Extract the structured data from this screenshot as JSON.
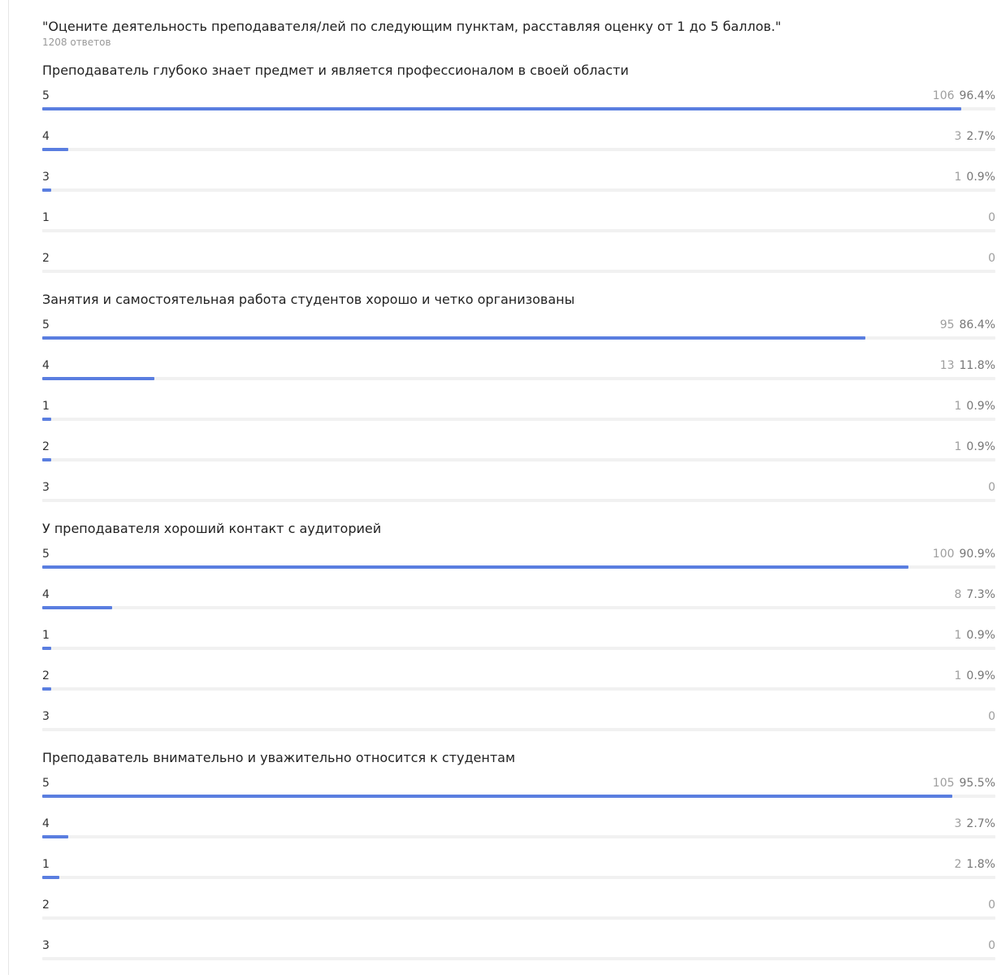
{
  "survey": {
    "question": "\"Оцените деятельность преподавателя/лей по следующим пунктам, расставляя оценку от 1 до 5 баллов.\"",
    "responses": "1208 ответов"
  },
  "colors": {
    "bar": "#5a7ee0",
    "track": "#f1f1f1"
  },
  "groups": [
    {
      "title": "Преподаватель глубоко знает предмет и является профессионалом в своей области",
      "rows": [
        {
          "label": "5",
          "count": "106",
          "percent": "96.4%",
          "fraction": 0.964
        },
        {
          "label": "4",
          "count": "3",
          "percent": "2.7%",
          "fraction": 0.027
        },
        {
          "label": "3",
          "count": "1",
          "percent": "0.9%",
          "fraction": 0.009
        },
        {
          "label": "1",
          "count": "0",
          "percent": "",
          "fraction": 0
        },
        {
          "label": "2",
          "count": "0",
          "percent": "",
          "fraction": 0
        }
      ]
    },
    {
      "title": "Занятия и самостоятельная работа студентов хорошо и четко организованы",
      "rows": [
        {
          "label": "5",
          "count": "95",
          "percent": "86.4%",
          "fraction": 0.864
        },
        {
          "label": "4",
          "count": "13",
          "percent": "11.8%",
          "fraction": 0.118
        },
        {
          "label": "1",
          "count": "1",
          "percent": "0.9%",
          "fraction": 0.009
        },
        {
          "label": "2",
          "count": "1",
          "percent": "0.9%",
          "fraction": 0.009
        },
        {
          "label": "3",
          "count": "0",
          "percent": "",
          "fraction": 0
        }
      ]
    },
    {
      "title": "У преподавателя хороший контакт с аудиторией",
      "rows": [
        {
          "label": "5",
          "count": "100",
          "percent": "90.9%",
          "fraction": 0.909
        },
        {
          "label": "4",
          "count": "8",
          "percent": "7.3%",
          "fraction": 0.073
        },
        {
          "label": "1",
          "count": "1",
          "percent": "0.9%",
          "fraction": 0.009
        },
        {
          "label": "2",
          "count": "1",
          "percent": "0.9%",
          "fraction": 0.009
        },
        {
          "label": "3",
          "count": "0",
          "percent": "",
          "fraction": 0
        }
      ]
    },
    {
      "title": "Преподаватель внимательно и уважительно относится к студентам",
      "rows": [
        {
          "label": "5",
          "count": "105",
          "percent": "95.5%",
          "fraction": 0.955
        },
        {
          "label": "4",
          "count": "3",
          "percent": "2.7%",
          "fraction": 0.027
        },
        {
          "label": "1",
          "count": "2",
          "percent": "1.8%",
          "fraction": 0.018
        },
        {
          "label": "2",
          "count": "0",
          "percent": "",
          "fraction": 0
        },
        {
          "label": "3",
          "count": "0",
          "percent": "",
          "fraction": 0
        }
      ]
    }
  ]
}
